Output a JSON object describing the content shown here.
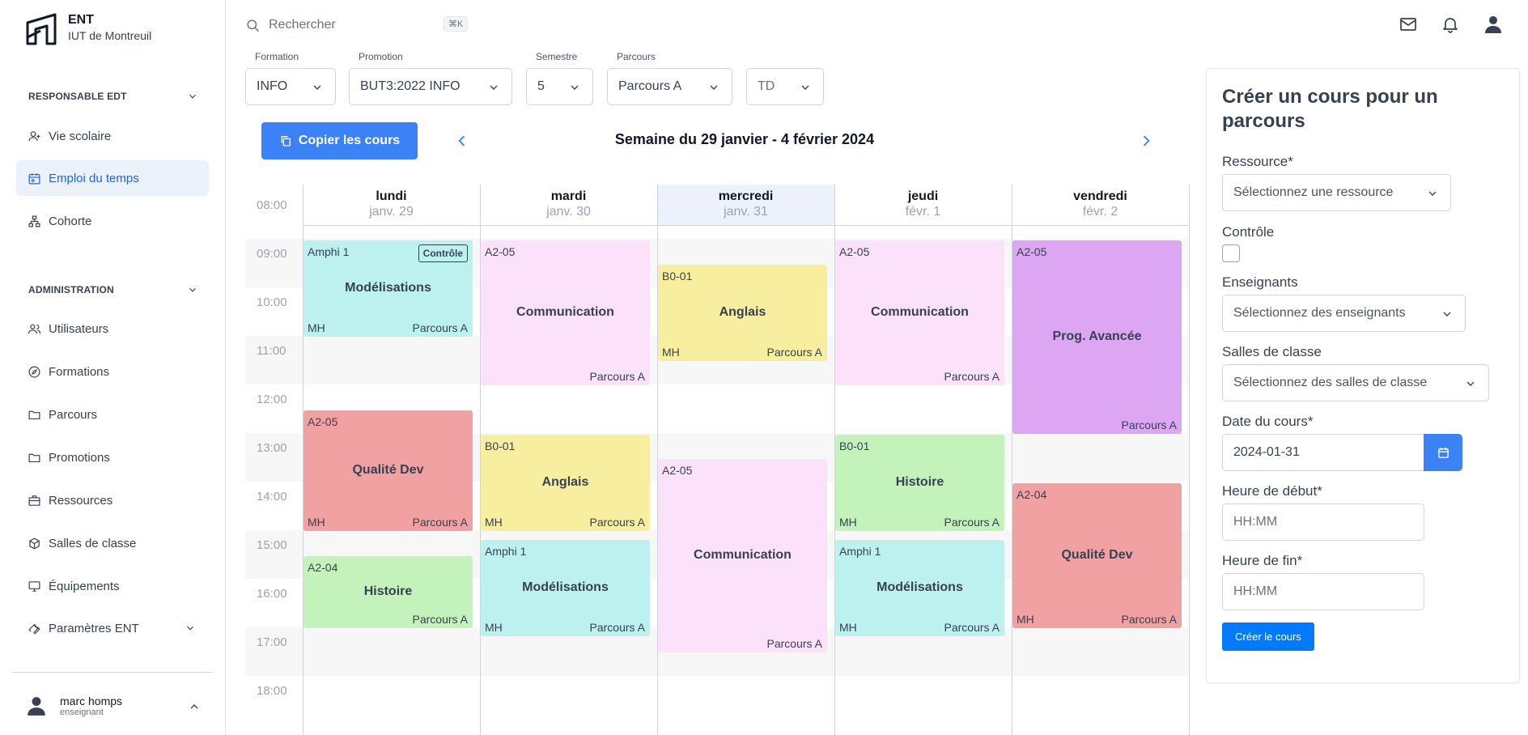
{
  "app": {
    "title": "ENT",
    "subtitle": "IUT de Montreuil"
  },
  "sidebar": {
    "sections": [
      {
        "heading": "RESPONSABLE EDT",
        "items": [
          {
            "label": "Vie scolaire",
            "icon": "user-icon"
          },
          {
            "label": "Emploi du temps",
            "icon": "calendar-icon",
            "active": true
          },
          {
            "label": "Cohorte",
            "icon": "hierarchy-icon"
          }
        ]
      },
      {
        "heading": "ADMINISTRATION",
        "items": [
          {
            "label": "Utilisateurs",
            "icon": "users-icon"
          },
          {
            "label": "Formations",
            "icon": "compass-icon"
          },
          {
            "label": "Parcours",
            "icon": "folder-icon"
          },
          {
            "label": "Promotions",
            "icon": "folder-icon"
          },
          {
            "label": "Ressources",
            "icon": "briefcase-icon"
          },
          {
            "label": "Salles de classe",
            "icon": "cube-icon"
          },
          {
            "label": "Équipements",
            "icon": "monitor-icon"
          },
          {
            "label": "Paramètres ENT",
            "icon": "wrench-icon"
          }
        ]
      }
    ],
    "user": {
      "name": "marc homps",
      "role": "enseignant"
    }
  },
  "search": {
    "placeholder": "Rechercher",
    "shortcut": "⌘K"
  },
  "filters": {
    "formation": {
      "label": "Formation",
      "value": "INFO"
    },
    "promotion": {
      "label": "Promotion",
      "value": "BUT3:2022 INFO"
    },
    "semestre": {
      "label": "Semestre",
      "value": "5"
    },
    "parcours": {
      "label": "Parcours",
      "value": "Parcours A"
    },
    "type": {
      "value": "TD"
    }
  },
  "toolbar": {
    "copy_label": "Copier les cours"
  },
  "week": {
    "title": "Semaine du 29 janvier - 4 février 2024"
  },
  "calendar": {
    "days": [
      {
        "name": "lundi",
        "date": "janv. 29"
      },
      {
        "name": "mardi",
        "date": "janv. 30"
      },
      {
        "name": "mercredi",
        "date": "janv. 31",
        "today": true
      },
      {
        "name": "jeudi",
        "date": "févr. 1"
      },
      {
        "name": "vendredi",
        "date": "févr. 2"
      }
    ],
    "hours": [
      "08:00",
      "09:00",
      "10:00",
      "11:00",
      "12:00",
      "13:00",
      "14:00",
      "15:00",
      "16:00",
      "17:00",
      "18:00"
    ],
    "events": [
      {
        "day": 0,
        "start": "09:00",
        "end": "11:00",
        "room": "Amphi 1",
        "title": "Modélisations",
        "teacher": "MH",
        "parcours": "Parcours A",
        "badge": "Contrôle",
        "color": "#bdf1f0"
      },
      {
        "day": 0,
        "start": "12:30",
        "end": "15:00",
        "room": "A2-05",
        "title": "Qualité Dev",
        "teacher": "MH",
        "parcours": "Parcours A",
        "color": "#f1a1a1"
      },
      {
        "day": 0,
        "start": "15:30",
        "end": "17:00",
        "room": "A2-04",
        "title": "Histoire",
        "teacher": "",
        "parcours": "Parcours A",
        "color": "#c3f3bb"
      },
      {
        "day": 1,
        "start": "09:00",
        "end": "12:00",
        "room": "A2-05",
        "title": "Communication",
        "teacher": "",
        "parcours": "Parcours A",
        "color": "#fbe1f9"
      },
      {
        "day": 1,
        "start": "13:00",
        "end": "15:00",
        "room": "B0-01",
        "title": "Anglais",
        "teacher": "MH",
        "parcours": "Parcours A",
        "color": "#f7ef9f"
      },
      {
        "day": 1,
        "start": "15:10",
        "end": "17:10",
        "room": "Amphi 1",
        "title": "Modélisations",
        "teacher": "MH",
        "parcours": "Parcours A",
        "color": "#bdf1f0"
      },
      {
        "day": 2,
        "start": "09:30",
        "end": "11:30",
        "room": "B0-01",
        "title": "Anglais",
        "teacher": "MH",
        "parcours": "Parcours A",
        "color": "#f7ef9f"
      },
      {
        "day": 2,
        "start": "13:30",
        "end": "17:30",
        "room": "A2-05",
        "title": "Communication",
        "teacher": "",
        "parcours": "Parcours A",
        "color": "#fbe1f9"
      },
      {
        "day": 3,
        "start": "09:00",
        "end": "12:00",
        "room": "A2-05",
        "title": "Communication",
        "teacher": "",
        "parcours": "Parcours A",
        "color": "#fbe1f9"
      },
      {
        "day": 3,
        "start": "13:00",
        "end": "15:00",
        "room": "B0-01",
        "title": "Histoire",
        "teacher": "MH",
        "parcours": "Parcours A",
        "color": "#c3f3bb"
      },
      {
        "day": 3,
        "start": "15:10",
        "end": "17:10",
        "room": "Amphi 1",
        "title": "Modélisations",
        "teacher": "MH",
        "parcours": "Parcours A",
        "color": "#bdf1f0"
      },
      {
        "day": 4,
        "start": "09:00",
        "end": "13:00",
        "room": "A2-05",
        "title": "Prog. Avancée",
        "teacher": "",
        "parcours": "Parcours A",
        "color": "#dca6f3"
      },
      {
        "day": 4,
        "start": "14:00",
        "end": "17:00",
        "room": "A2-04",
        "title": "Qualité Dev",
        "teacher": "MH",
        "parcours": "Parcours A",
        "color": "#f1a1a1"
      }
    ]
  },
  "form": {
    "title": "Créer un cours pour un parcours",
    "ressource": {
      "label": "Ressource*",
      "placeholder": "Sélectionnez une ressource"
    },
    "controle": {
      "label": "Contrôle"
    },
    "enseignants": {
      "label": "Enseignants",
      "placeholder": "Sélectionnez des enseignants"
    },
    "salles": {
      "label": "Salles de classe",
      "placeholder": "Sélectionnez des salles de classe"
    },
    "date": {
      "label": "Date du cours*",
      "value": "2024-01-31"
    },
    "debut": {
      "label": "Heure de début*",
      "placeholder": "HH:MM"
    },
    "fin": {
      "label": "Heure de fin*",
      "placeholder": "HH:MM"
    },
    "submit_label": "Créer le cours"
  },
  "colors": {
    "accent": "#3b82f6",
    "active_nav_bg": "#ebf2fc"
  }
}
